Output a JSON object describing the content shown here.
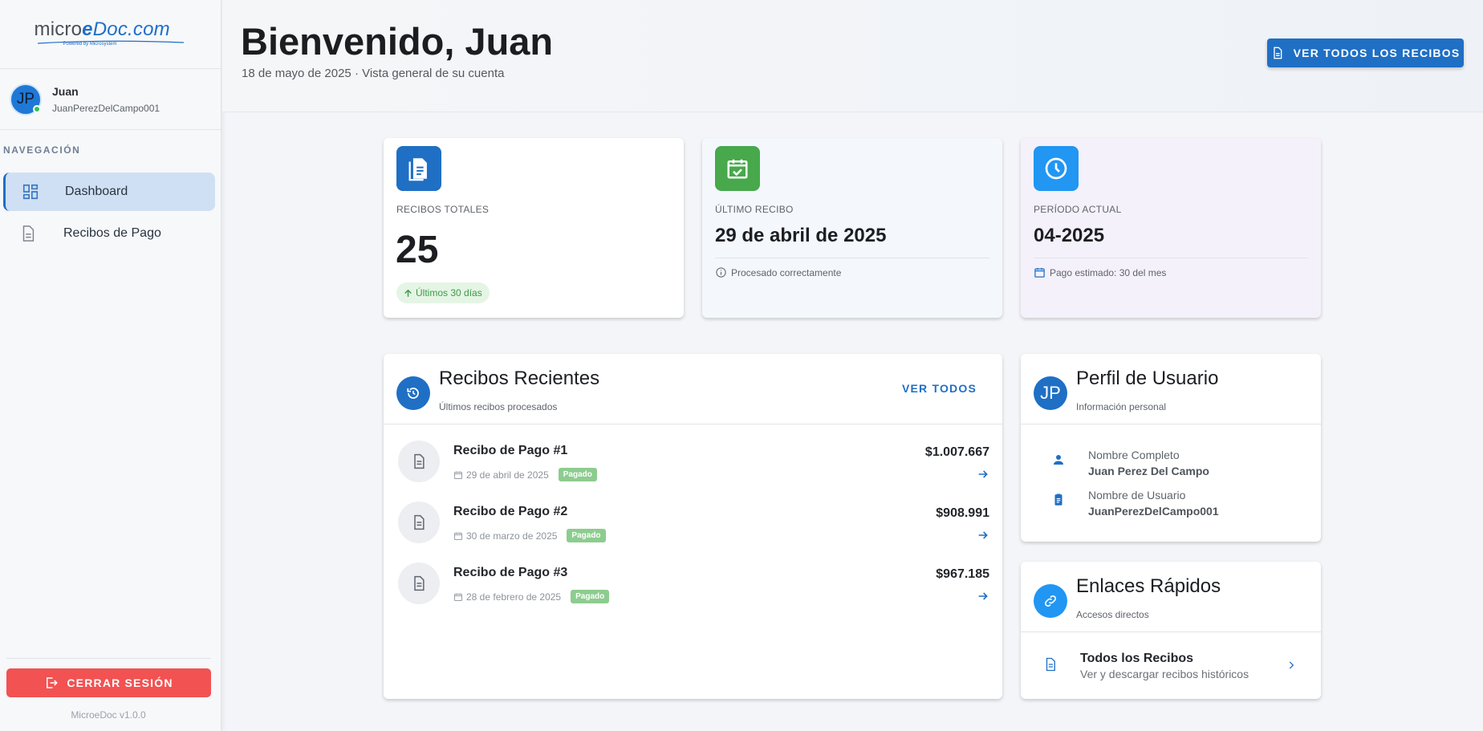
{
  "brand": {
    "name_part1": "micro",
    "name_part2": "e",
    "name_part3": "Doc.com",
    "tagline": "Powered by Microsystem"
  },
  "user": {
    "initials": "JP",
    "name": "Juan",
    "username": "JuanPerezDelCampo001"
  },
  "sidebar": {
    "nav_title": "NAVEGACIÓN",
    "items": [
      {
        "label": "Dashboard",
        "icon": "dashboard-icon",
        "active": true
      },
      {
        "label": "Recibos de Pago",
        "icon": "document-icon",
        "active": false
      }
    ],
    "logout_label": "CERRAR SESIÓN",
    "version": "MicroeDoc v1.0.0"
  },
  "header": {
    "title": "Bienvenido, Juan",
    "subtitle": "18 de mayo de 2025 · Vista general de su cuenta",
    "view_all_label": "VER TODOS LOS RECIBOS"
  },
  "stats": [
    {
      "label": "RECIBOS TOTALES",
      "value": "25",
      "chip": "Últimos 30 días",
      "icon": "receipt-icon",
      "color": "#1f6fc5"
    },
    {
      "label": "ÚLTIMO RECIBO",
      "value": "29 de abril de 2025",
      "foot": "Procesado correctamente",
      "icon": "calendar-check-icon",
      "color": "#47a84c"
    },
    {
      "label": "PERÍODO ACTUAL",
      "value": "04-2025",
      "foot": "Pago estimado: 30 del mes",
      "icon": "clock-icon",
      "color": "#2196f3"
    }
  ],
  "recent": {
    "title": "Recibos Recientes",
    "subtitle": "Últimos recibos procesados",
    "link": "VER TODOS",
    "items": [
      {
        "title": "Recibo de Pago #1",
        "date": "29 de abril de 2025",
        "status": "Pagado",
        "amount": "$1.007.667"
      },
      {
        "title": "Recibo de Pago #2",
        "date": "30 de marzo de 2025",
        "status": "Pagado",
        "amount": "$908.991"
      },
      {
        "title": "Recibo de Pago #3",
        "date": "28 de febrero de 2025",
        "status": "Pagado",
        "amount": "$967.185"
      }
    ]
  },
  "profile": {
    "initials": "JP",
    "title": "Perfil de Usuario",
    "subtitle": "Información personal",
    "full_name_label": "Nombre Completo",
    "full_name": "Juan Perez Del Campo",
    "username_label": "Nombre de Usuario",
    "username": "JuanPerezDelCampo001"
  },
  "quick_links": {
    "title": "Enlaces Rápidos",
    "subtitle": "Accesos directos",
    "link_title": "Todos los Recibos",
    "link_sub": "Ver y descargar recibos históricos"
  },
  "colors": {
    "primary": "#1f6fc5",
    "success": "#47a84c",
    "info": "#2196f3",
    "danger": "#f25252"
  }
}
